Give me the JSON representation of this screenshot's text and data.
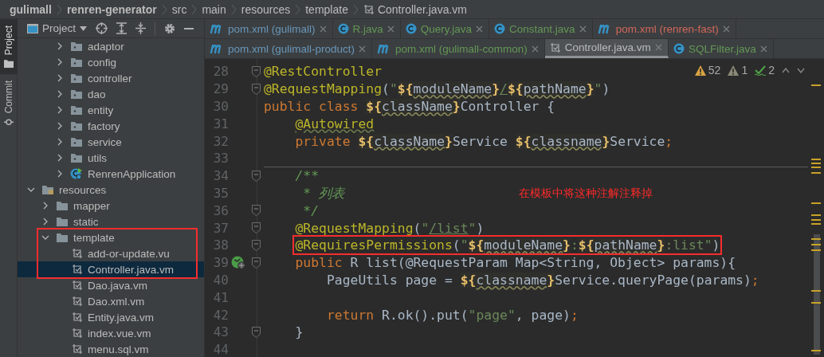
{
  "breadcrumbs": [
    {
      "label": "gulimall",
      "kind": "module"
    },
    {
      "label": "renren-generator",
      "kind": "module"
    },
    {
      "label": "src",
      "kind": "dir"
    },
    {
      "label": "main",
      "kind": "dir"
    },
    {
      "label": "resources",
      "kind": "dir"
    },
    {
      "label": "template",
      "kind": "dir"
    },
    {
      "label": "Controller.java.vm",
      "kind": "template"
    }
  ],
  "side_strip": [
    {
      "label": "Project",
      "kind": "project",
      "selected": true
    },
    {
      "label": "Commit",
      "kind": "commit",
      "selected": false
    }
  ],
  "project_panel": {
    "title": "Project",
    "tree": [
      {
        "children": [
          {
            "children": [
              {
                "label": "adaptor",
                "kind": "package",
                "expanded": false,
                "selected": false,
                "boxed": false
              },
              {
                "label": "config",
                "kind": "package",
                "expanded": false,
                "selected": false,
                "boxed": false
              },
              {
                "label": "controller",
                "kind": "package",
                "expanded": false,
                "selected": false,
                "boxed": false
              },
              {
                "label": "dao",
                "kind": "package",
                "expanded": false,
                "selected": false,
                "boxed": false
              },
              {
                "label": "entity",
                "kind": "package",
                "expanded": false,
                "selected": false,
                "boxed": false
              },
              {
                "label": "factory",
                "kind": "package",
                "expanded": false,
                "selected": false,
                "boxed": false
              },
              {
                "label": "service",
                "kind": "package",
                "expanded": false,
                "selected": false,
                "boxed": false
              },
              {
                "label": "utils",
                "kind": "package",
                "expanded": false,
                "selected": false,
                "boxed": false
              },
              {
                "label": "RenrenApplication",
                "kind": "app",
                "expanded": false,
                "selected": false,
                "boxed": false
              }
            ]
          }
        ]
      },
      {
        "label": "resources",
        "kind": "resources",
        "expanded": true,
        "selected": false,
        "boxed": false,
        "children": [
          {
            "label": "mapper",
            "kind": "folder",
            "expanded": false,
            "selected": false,
            "boxed": false
          },
          {
            "label": "static",
            "kind": "folder",
            "expanded": false,
            "selected": false,
            "boxed": false
          },
          {
            "label": "template",
            "kind": "folder",
            "expanded": true,
            "selected": false,
            "boxed": true,
            "children": [
              {
                "label": "add-or-update.vu",
                "kind": "template",
                "selected": false,
                "boxed": true
              },
              {
                "label": "Controller.java.vm",
                "kind": "template",
                "selected": true,
                "boxed": true
              },
              {
                "label": "Dao.java.vm",
                "kind": "template",
                "selected": false,
                "boxed": false
              },
              {
                "label": "Dao.xml.vm",
                "kind": "template",
                "selected": false,
                "boxed": false
              },
              {
                "label": "Entity.java.vm",
                "kind": "template",
                "selected": false,
                "boxed": false
              },
              {
                "label": "index.vue.vm",
                "kind": "template",
                "selected": false,
                "boxed": false
              },
              {
                "label": "menu.sql.vm",
                "kind": "template",
                "selected": false,
                "boxed": false
              }
            ]
          }
        ]
      }
    ]
  },
  "tab_rows": [
    [
      {
        "label": "pom.xml (gulimall)",
        "kind": "maven",
        "color": "#6897bb",
        "selected": false
      },
      {
        "label": "R.java",
        "kind": "class",
        "color": "#629755",
        "selected": false
      },
      {
        "label": "Query.java",
        "kind": "class",
        "color": "#629755",
        "selected": false
      },
      {
        "label": "Constant.java",
        "kind": "class",
        "color": "#629755",
        "selected": false
      },
      {
        "label": "pom.xml (renren-fast)",
        "kind": "maven",
        "color": "#d1675a",
        "selected": false
      }
    ],
    [
      {
        "label": "pom.xml (gulimall-product)",
        "kind": "maven",
        "color": "#6897bb",
        "selected": false
      },
      {
        "label": "pom.xml (gulimall-common)",
        "kind": "maven",
        "color": "#629755",
        "selected": false
      },
      {
        "label": "Controller.java.vm",
        "kind": "template",
        "color": "#bbbbbb",
        "selected": true
      },
      {
        "label": "SQLFilter.java",
        "kind": "class",
        "color": "#629755",
        "selected": false
      }
    ]
  ],
  "inspections": [
    {
      "kind": "warning",
      "count": "52"
    },
    {
      "kind": "weak-warning",
      "count": "1"
    },
    {
      "kind": "typo",
      "count": "2"
    }
  ],
  "note": "在模板中将这种注解注释掉",
  "code_lines": [
    {
      "number": "28",
      "fold": true,
      "separator": false,
      "boxed": false,
      "tokens": [
        {
          "text": "@RestController",
          "kind": "annotation"
        }
      ]
    },
    {
      "number": "29",
      "fold": true,
      "separator": false,
      "boxed": false,
      "tokens": [
        {
          "text": "@RequestMapping",
          "kind": "annotation"
        },
        {
          "text": "(",
          "kind": "plain"
        },
        {
          "text": "\"",
          "kind": "string"
        },
        {
          "text": "${",
          "kind": "brace"
        },
        {
          "text": "moduleName",
          "kind": "var"
        },
        {
          "text": "}",
          "kind": "brace"
        },
        {
          "text": "/",
          "kind": "link"
        },
        {
          "text": "${",
          "kind": "brace"
        },
        {
          "text": "pathName",
          "kind": "var"
        },
        {
          "text": "}",
          "kind": "brace"
        },
        {
          "text": "\"",
          "kind": "string"
        },
        {
          "text": ")",
          "kind": "plain"
        }
      ]
    },
    {
      "number": "30",
      "fold": false,
      "separator": false,
      "boxed": false,
      "tokens": [
        {
          "text": "public class ",
          "kind": "keyword"
        },
        {
          "text": "${",
          "kind": "brace"
        },
        {
          "text": "className",
          "kind": "var"
        },
        {
          "text": "}",
          "kind": "brace"
        },
        {
          "text": "Controller {",
          "kind": "plain"
        }
      ]
    },
    {
      "number": "31",
      "fold": false,
      "separator": false,
      "boxed": false,
      "tokens": [
        {
          "text": "    @Autowired",
          "kind": "annotation-typo"
        }
      ]
    },
    {
      "number": "32",
      "fold": false,
      "separator": false,
      "boxed": false,
      "tokens": [
        {
          "text": "    private ",
          "kind": "keyword"
        },
        {
          "text": "${",
          "kind": "brace"
        },
        {
          "text": "className",
          "kind": "var"
        },
        {
          "text": "}",
          "kind": "brace"
        },
        {
          "text": "Service ",
          "kind": "plain"
        },
        {
          "text": "${",
          "kind": "brace"
        },
        {
          "text": "classname",
          "kind": "var"
        },
        {
          "text": "}",
          "kind": "brace"
        },
        {
          "text": "Service",
          "kind": "plain"
        },
        {
          "text": ";",
          "kind": "keyword"
        }
      ]
    },
    {
      "number": "33",
      "fold": false,
      "separator": false,
      "boxed": false
    },
    {
      "number": "34",
      "fold": true,
      "separator": true,
      "boxed": false,
      "tokens": [
        {
          "text": "    /**",
          "kind": "comment"
        }
      ]
    },
    {
      "number": "35",
      "fold": false,
      "separator": false,
      "boxed": false,
      "tokens": [
        {
          "text": "     * 列表",
          "kind": "comment"
        }
      ]
    },
    {
      "number": "36",
      "fold": true,
      "separator": false,
      "boxed": false,
      "tokens": [
        {
          "text": "     */",
          "kind": "comment"
        }
      ]
    },
    {
      "number": "37",
      "fold": true,
      "separator": false,
      "boxed": false,
      "tokens": [
        {
          "text": "    @RequestMapping",
          "kind": "annotation"
        },
        {
          "text": "(",
          "kind": "plain"
        },
        {
          "text": "\"",
          "kind": "string"
        },
        {
          "text": "/list",
          "kind": "link"
        },
        {
          "text": "\"",
          "kind": "string"
        },
        {
          "text": ")",
          "kind": "plain"
        }
      ]
    },
    {
      "number": "38",
      "fold": true,
      "separator": false,
      "boxed": true,
      "tokens": [
        {
          "text": "    @RequiresPermissions",
          "kind": "annotation"
        },
        {
          "text": "(",
          "kind": "plain"
        },
        {
          "text": "\"",
          "kind": "string"
        },
        {
          "text": "${",
          "kind": "brace"
        },
        {
          "text": "moduleName",
          "kind": "var"
        },
        {
          "text": "}",
          "kind": "brace"
        },
        {
          "text": ":",
          "kind": "string"
        },
        {
          "text": "${",
          "kind": "brace"
        },
        {
          "text": "pathName",
          "kind": "var"
        },
        {
          "text": "}",
          "kind": "brace"
        },
        {
          "text": ":list\"",
          "kind": "string"
        },
        {
          "text": ")",
          "kind": "plain"
        }
      ]
    },
    {
      "number": "39",
      "fold": true,
      "separator": false,
      "boxed": false,
      "endpoint": true,
      "tokens": [
        {
          "text": "    public ",
          "kind": "keyword"
        },
        {
          "text": "R list(@RequestParam Map<String, Object> params){",
          "kind": "plain"
        }
      ]
    },
    {
      "number": "40",
      "fold": false,
      "separator": false,
      "boxed": false,
      "tokens": [
        {
          "text": "        PageUtils page = ",
          "kind": "plain"
        },
        {
          "text": "${",
          "kind": "brace"
        },
        {
          "text": "classname",
          "kind": "var"
        },
        {
          "text": "}",
          "kind": "brace"
        },
        {
          "text": "Service.queryPage(params)",
          "kind": "plain"
        },
        {
          "text": ";",
          "kind": "keyword"
        }
      ]
    },
    {
      "number": "41",
      "fold": false,
      "separator": false,
      "boxed": false
    },
    {
      "number": "42",
      "fold": false,
      "separator": false,
      "boxed": false,
      "tokens": [
        {
          "text": "        return ",
          "kind": "keyword"
        },
        {
          "text": "R.ok().put(",
          "kind": "plain"
        },
        {
          "text": "\"page\"",
          "kind": "string"
        },
        {
          "text": ", page)",
          "kind": "plain"
        },
        {
          "text": ";",
          "kind": "keyword"
        }
      ]
    },
    {
      "number": "43",
      "fold": true,
      "separator": false,
      "boxed": false,
      "tokens": [
        {
          "text": "    }",
          "kind": "plain"
        }
      ]
    },
    {
      "number": "44",
      "fold": false,
      "separator": false,
      "boxed": false
    }
  ]
}
